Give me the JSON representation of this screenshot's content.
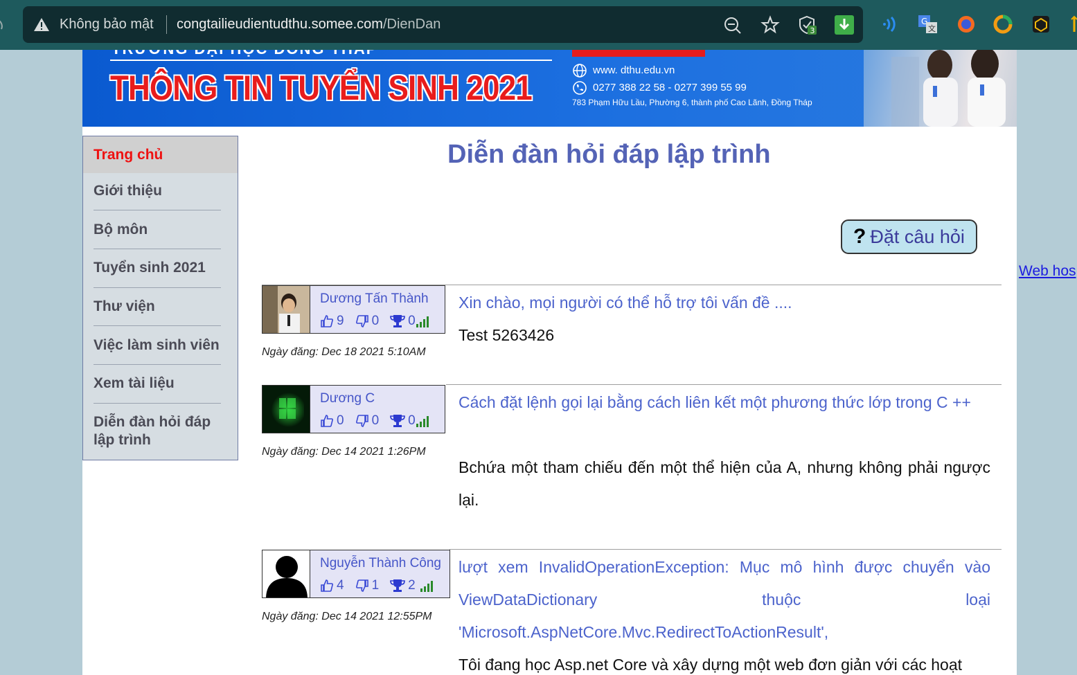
{
  "browser": {
    "security_label": "Không bảo mật",
    "url_host": "congtailieudientudthu.somee.com",
    "url_path": "/DienDan",
    "shield_badge": "3"
  },
  "banner": {
    "school": "TRƯỜNG ĐẠI HỌC ĐỒNG THÁP",
    "title": "THÔNG TIN TUYỂN SINH 2021",
    "website": "www. dthu.edu.vn",
    "phone": "0277 388 22 58  -  0277 399 55 99",
    "address": "783 Phạm Hữu Lầu, Phường 6, thành phố Cao Lãnh, Đồng Tháp"
  },
  "sidebar": {
    "items": [
      {
        "label": "Trang chủ"
      },
      {
        "label": "Giới thiệu"
      },
      {
        "label": "Bộ môn"
      },
      {
        "label": "Tuyển sinh 2021"
      },
      {
        "label": "Thư viện"
      },
      {
        "label": "Việc làm sinh viên"
      },
      {
        "label": "Xem tài liệu"
      },
      {
        "label": "Diễn đàn hỏi đáp lập trình"
      }
    ]
  },
  "main": {
    "title": "Diễn đàn hỏi đáp lập trình",
    "ask_button": "Đặt câu hỏi",
    "date_prefix": "Ngày đăng:",
    "posts": [
      {
        "author": "Dương Tấn Thành",
        "likes": "9",
        "dislikes": "0",
        "trophies": "0",
        "date": "Ngày đăng: Dec 18 2021 5:10AM",
        "title": "Xin chào, mọi người có thể hỗ trợ tôi vấn đề ....",
        "body": "Test 5263426"
      },
      {
        "author": "Dương C",
        "likes": "0",
        "dislikes": "0",
        "trophies": "0",
        "date": "Ngày đăng: Dec 14 2021 1:26PM",
        "title": "Cách đặt lệnh gọi lại bằng cách liên kết một phương thức lớp trong C ++",
        "body": "Bchứa một tham chiếu đến một thể hiện của A, nhưng không phải ngược lại."
      },
      {
        "author": "Nguyễn Thành Công",
        "likes": "4",
        "dislikes": "1",
        "trophies": "2",
        "date": "Ngày đăng: Dec 14 2021 12:55PM",
        "title": "lượt xem InvalidOperationException: Mục mô hình được chuyển vào ViewDataDictionary thuộc loại 'Microsoft.AspNetCore.Mvc.RedirectToActionResult',",
        "body": "Tôi đang học Asp.net Core và xây dựng một web đơn giản với các hoạt"
      }
    ]
  },
  "side_link": "Web hos",
  "colors": {
    "chrome_bg": "#1e5a5d",
    "accent_title": "#5463b6",
    "link_blue": "#4c63cc",
    "active_red": "#ee1111"
  }
}
